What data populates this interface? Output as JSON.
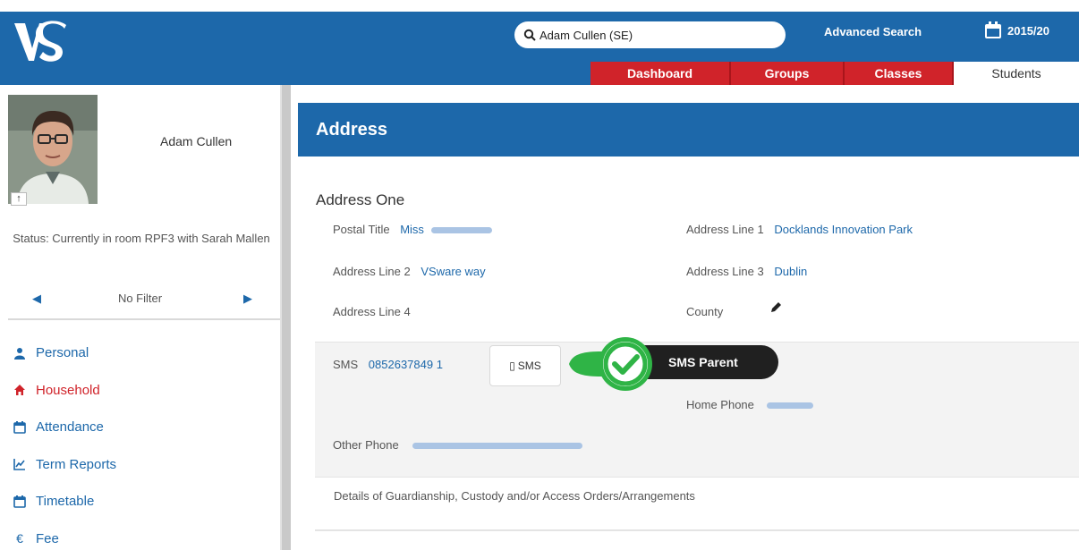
{
  "header": {
    "search_value": "Adam Cullen (SE)",
    "advanced_search": "Advanced Search",
    "year_label": "2015/20"
  },
  "tabs": [
    {
      "label": "Dashboard"
    },
    {
      "label": "Groups"
    },
    {
      "label": "Classes"
    },
    {
      "label": "Students"
    }
  ],
  "student": {
    "name": "Adam Cullen",
    "status": "Status: Currently in room RPF3 with Sarah Mallen",
    "filter": "No Filter"
  },
  "nav": [
    {
      "label": "Personal",
      "icon": "user-icon"
    },
    {
      "label": "Household",
      "icon": "home-icon"
    },
    {
      "label": "Attendance",
      "icon": "calendar-icon"
    },
    {
      "label": "Term Reports",
      "icon": "chart-icon"
    },
    {
      "label": "Timetable",
      "icon": "calendar-icon"
    },
    {
      "label": "Fee",
      "icon": "euro-icon"
    }
  ],
  "section": {
    "title": "Address",
    "subtitle": "Address One"
  },
  "fields": {
    "postal_title_label": "Postal Title",
    "postal_title_value": "Miss",
    "address_line1_label": "Address Line 1",
    "address_line1_value": "Docklands Innovation Park",
    "address_line2_label": "Address Line 2",
    "address_line2_value": "VSware way",
    "address_line3_label": "Address Line 3",
    "address_line3_value": "Dublin",
    "address_line4_label": "Address Line 4",
    "county_label": "County",
    "sms_label": "SMS",
    "sms_value": "0852637849 1",
    "sms_button": "SMS",
    "home_phone_label": "Home Phone",
    "other_phone_label": "Other Phone"
  },
  "callout": {
    "label": "SMS Parent"
  },
  "guardianship": "Details of Guardianship, Custody and/or Access Orders/Arrangements",
  "colors": {
    "brand_blue": "#1d68aa",
    "tab_red": "#d0232a",
    "callout_green": "#2fb446"
  }
}
